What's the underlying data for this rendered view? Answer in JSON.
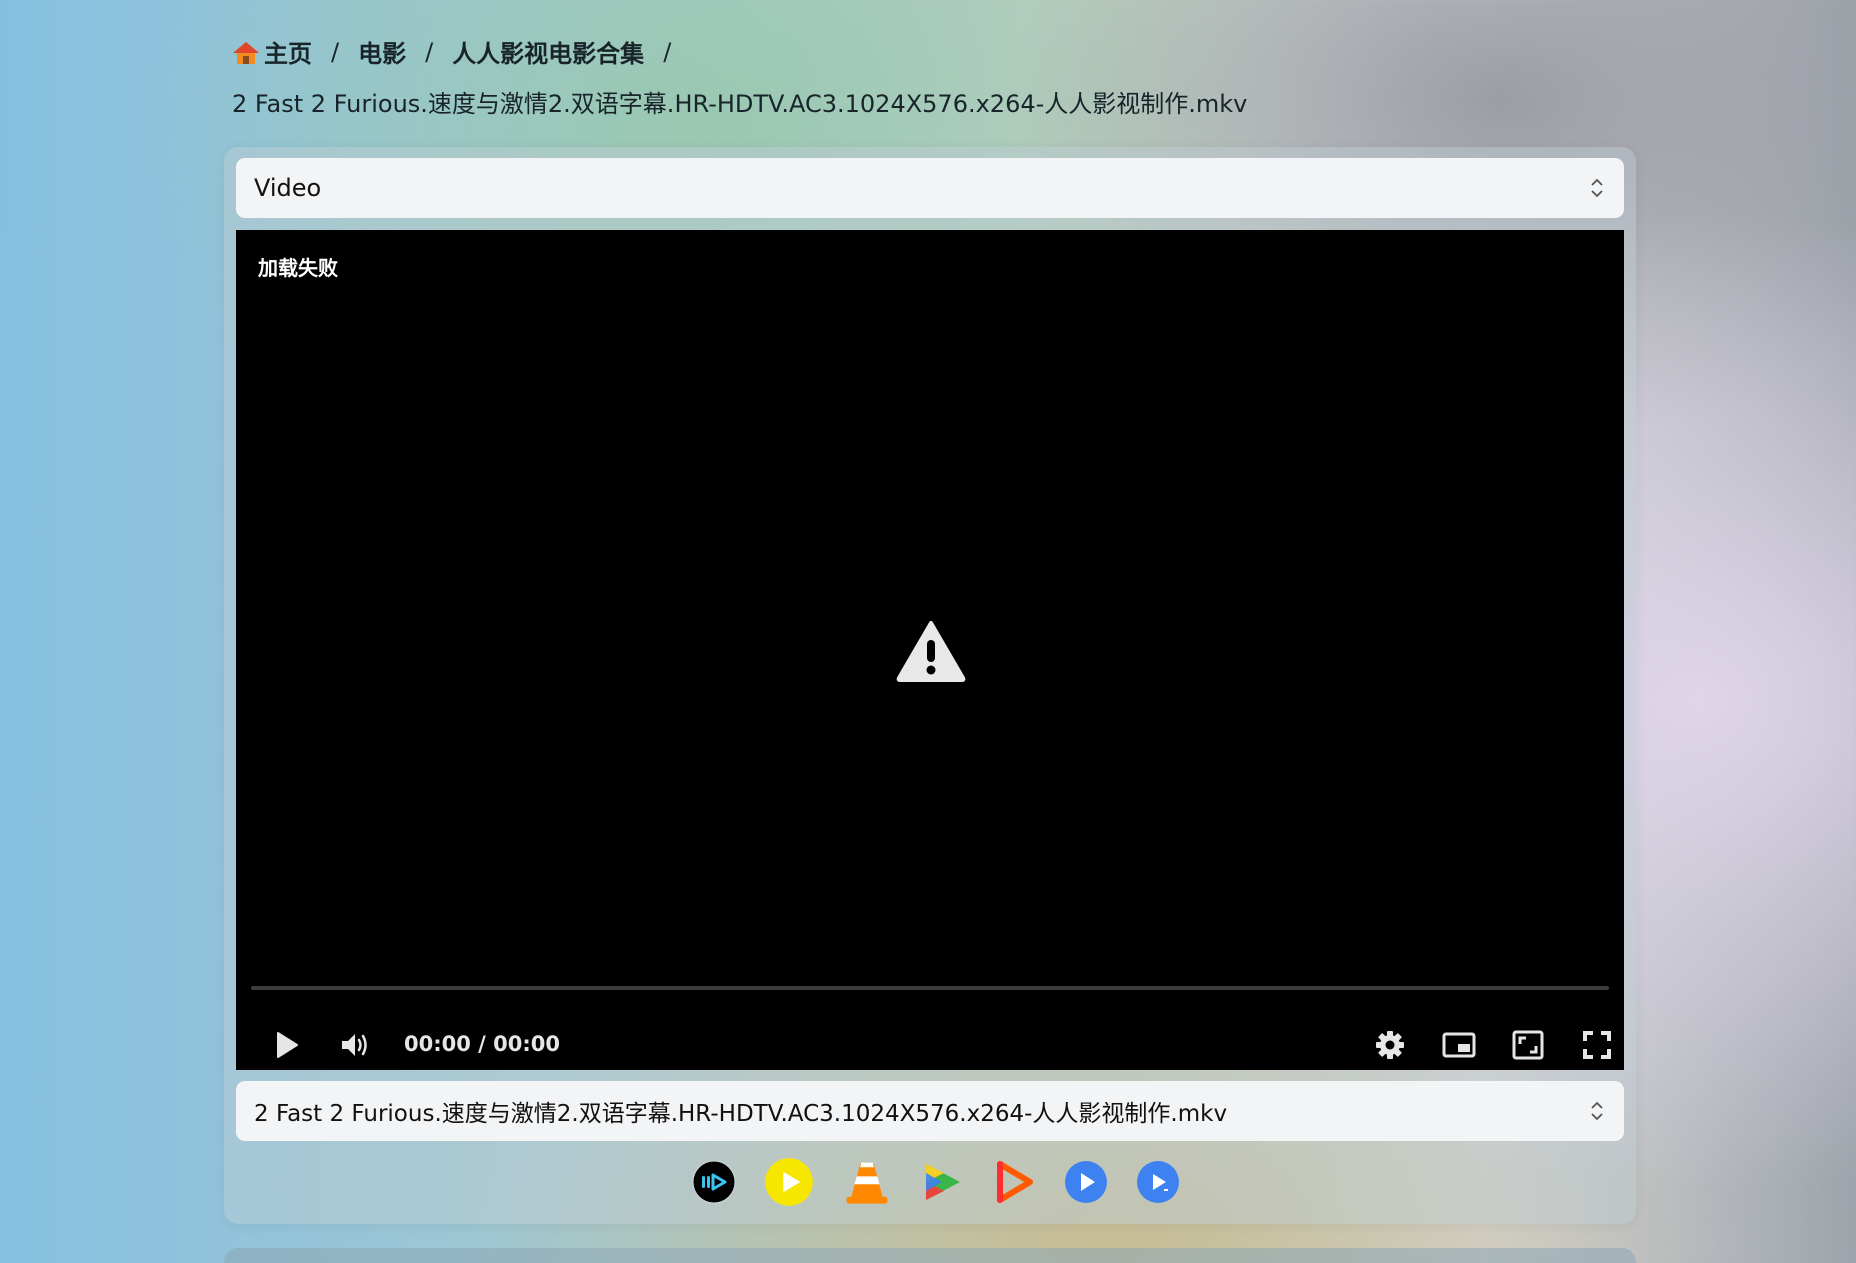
{
  "breadcrumb": {
    "items": [
      "主页",
      "电影",
      "人人影视电影合集"
    ],
    "separator": "/"
  },
  "file_title": "2 Fast 2 Furious.速度与激情2.双语字幕.HR-HDTV.AC3.1024X576.x264-人人影视制作.mkv",
  "source_select": {
    "value": "Video"
  },
  "player": {
    "error_text": "加载失败",
    "time_display": "00:00 / 00:00",
    "progress": 0
  },
  "file_select": {
    "value": "2 Fast 2 Furious.速度与激情2.双语字幕.HR-HDTV.AC3.1024X576.x264-人人影视制作.mkv"
  },
  "external_players": [
    {
      "name": "iina-icon",
      "color": "#000000"
    },
    {
      "name": "potplayer-icon",
      "color": "#f7e600"
    },
    {
      "name": "vlc-icon",
      "color": "#ff8800"
    },
    {
      "name": "nplayer-icon",
      "color": "#3ab54a"
    },
    {
      "name": "infuse-icon",
      "color": "#ff5a00"
    },
    {
      "name": "mpv-icon",
      "color": "#3d82f0"
    },
    {
      "name": "mx-player-icon",
      "color": "#3d82f0"
    }
  ]
}
